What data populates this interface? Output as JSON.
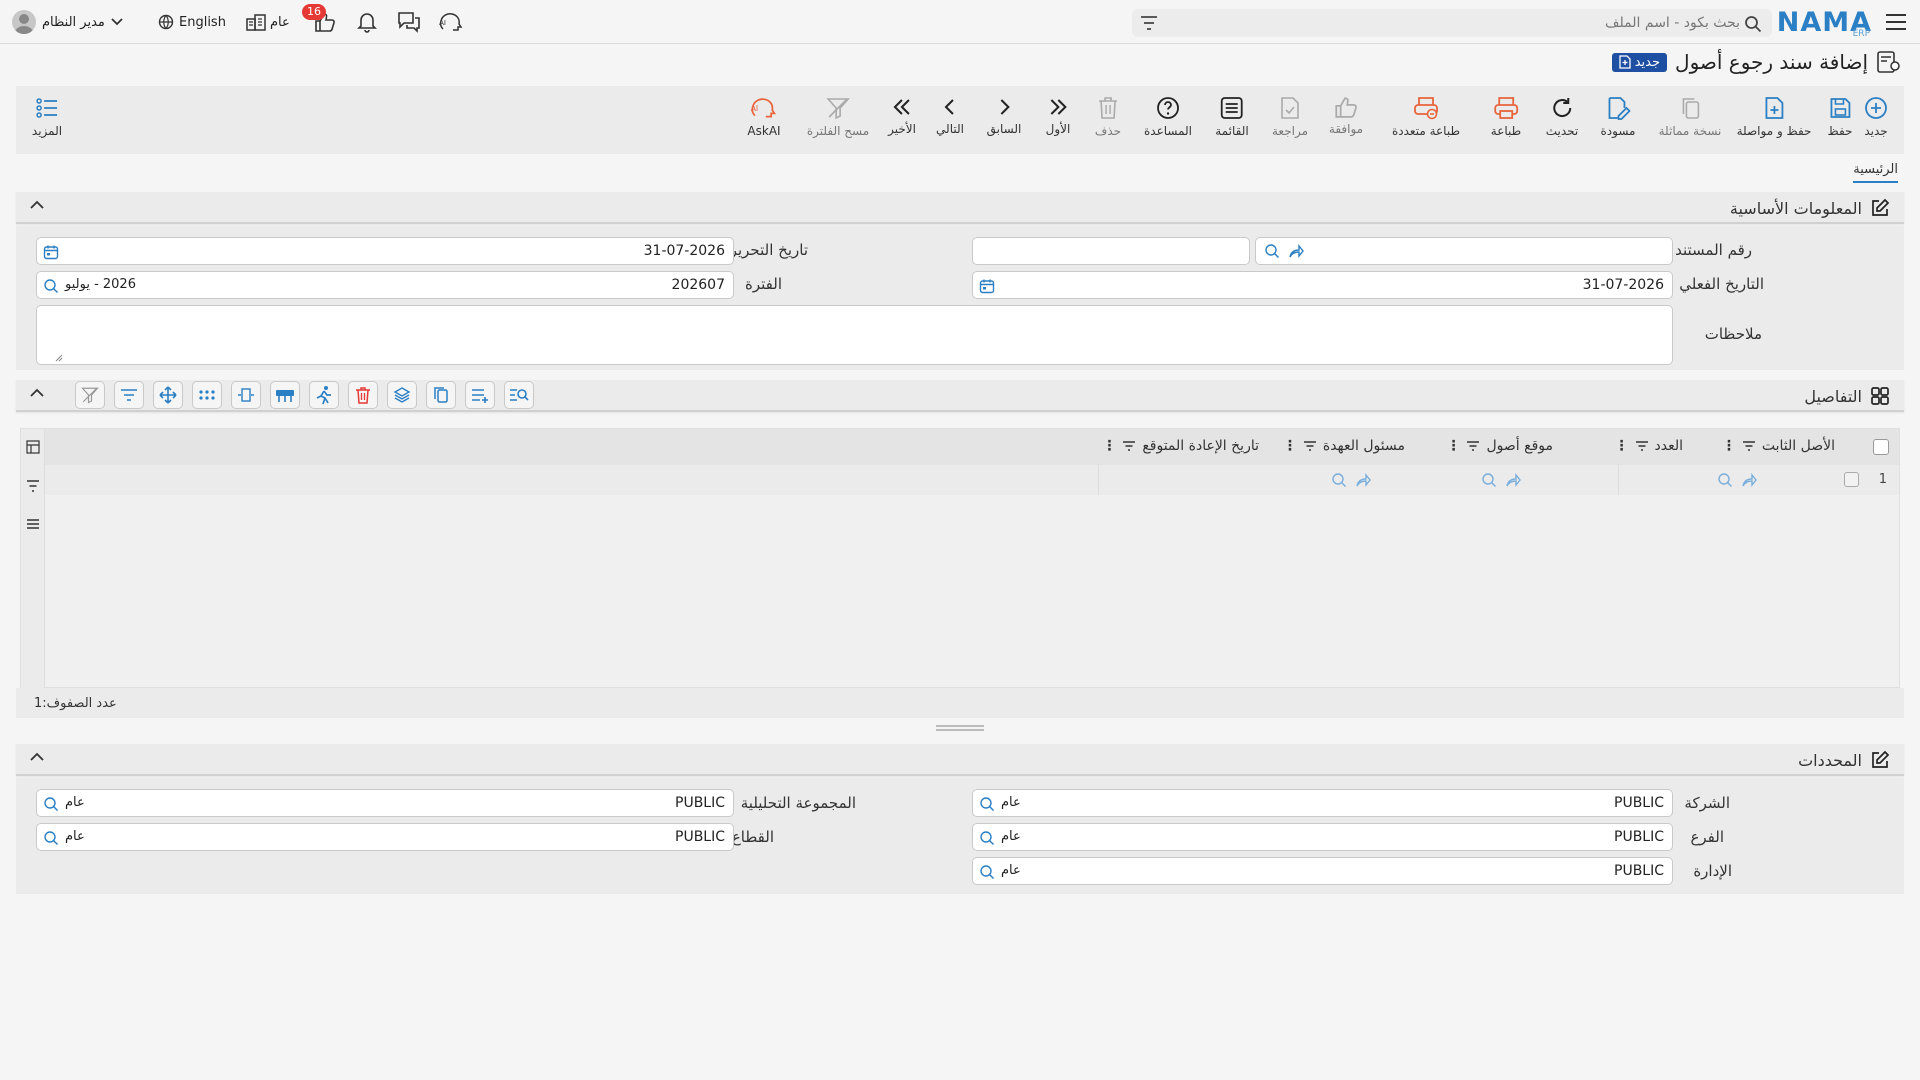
{
  "header": {
    "logo": "NAMA",
    "logo_sub": "ERP",
    "search_placeholder": "بحث بكود - اسم الملف",
    "user_name": "مدير النظام",
    "language": "English",
    "general_label": "عام",
    "notification_count": "16"
  },
  "page": {
    "title": "إضافة سند رجوع أصول",
    "status_badge": "جديد"
  },
  "toolbar": {
    "new": "جديد",
    "save": "حفظ",
    "save_continue": "حفظ و مواصلة",
    "duplicate": "نسخة مماثلة",
    "draft": "مسودة",
    "refresh": "تحديث",
    "print": "طباعة",
    "multi_print": "طباعة متعددة",
    "approve": "موافقة",
    "review": "مراجعة",
    "list": "القائمة",
    "help": "المساعدة",
    "delete": "حذف",
    "first": "الأول",
    "previous": "السابق",
    "next": "التالي",
    "last": "الأخير",
    "clear_filter": "مسح الفلترة",
    "askai": "AskAI",
    "more": "المزيد"
  },
  "tabs": {
    "main": "الرئيسية"
  },
  "basic_info": {
    "title": "المعلومات الأساسية",
    "doc_number_label": "رقم المستند",
    "doc_number_value": "",
    "doc_number_ref": "",
    "edit_date_label": "تاريخ التحرير",
    "edit_date_value": "31-07-2026",
    "actual_date_label": "التاريخ الفعلي",
    "actual_date_value": "31-07-2026",
    "period_label": "الفترة",
    "period_value": "202607",
    "period_name": "2026 - يوليو",
    "notes_label": "ملاحظات",
    "notes_value": ""
  },
  "details": {
    "title": "التفاصيل",
    "columns": [
      "الأصل الثابت",
      "العدد",
      "موقع أصول",
      "مسئول العهدة",
      "تاريخ الإعادة المتوقع"
    ],
    "rows": [
      {
        "num": "1"
      }
    ],
    "row_count_label": "عدد الصفوف:",
    "row_count": "1"
  },
  "dimensions": {
    "title": "المحددات",
    "company_label": "الشركة",
    "company_value": "PUBLIC",
    "company_name": "عام",
    "analytic_label": "المجموعة التحليلية",
    "analytic_value": "PUBLIC",
    "analytic_name": "عام",
    "branch_label": "الفرع",
    "branch_value": "PUBLIC",
    "branch_name": "عام",
    "sector_label": "القطاع",
    "sector_value": "PUBLIC",
    "sector_name": "عام",
    "department_label": "الإدارة",
    "department_value": "PUBLIC",
    "department_name": "عام"
  },
  "colors": {
    "brand": "#2b7fc4",
    "badge": "#1e4fa3",
    "print_orange": "#e8643c",
    "notify_red": "#e53935"
  }
}
